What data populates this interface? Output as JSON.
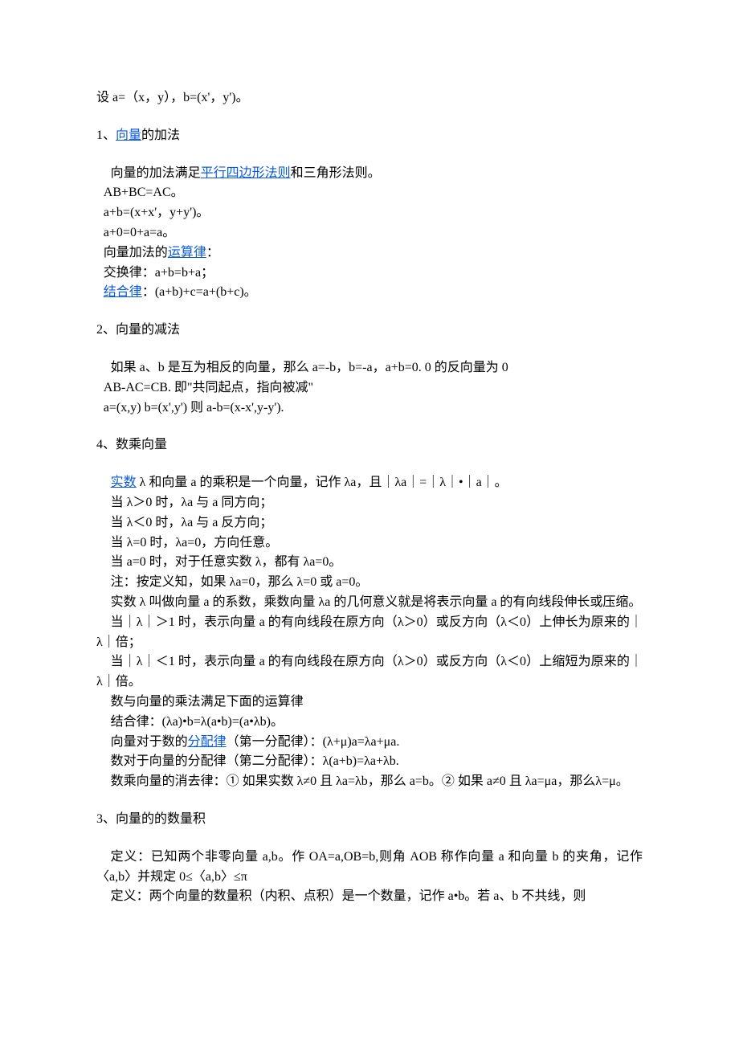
{
  "intro": "设 a=（x，y），b=(x'，y')。",
  "sec1": {
    "title": "1、",
    "link": "向量",
    "title_after": "的加法",
    "l1_pre": "向量的加法满足",
    "l1_link": "平行四边形法则",
    "l1_post": "和三角形法则。",
    "l2": "AB+BC=AC。",
    "l3": "a+b=(x+x'，y+y')。",
    "l4": "a+0=0+a=a。",
    "l5_pre": "向量加法的",
    "l5_link": "运算律",
    "l5_post": "：",
    "l6": "交换律：a+b=b+a；",
    "l7_link": "结合律",
    "l7_post": "：(a+b)+c=a+(b+c)。"
  },
  "sec2": {
    "title": "2、向量的减法",
    "l1": "如果 a、b 是互为相反的向量，那么 a=-b，b=-a，a+b=0. 0 的反向量为 0",
    "l2": "AB-AC=CB.  即\"共同起点，指向被减\"",
    "l3": "a=(x,y) b=(x',y')  则  a-b=(x-x',y-y')."
  },
  "sec4": {
    "title": "4、数乘向量",
    "l1_link": "实数",
    "l1_post": " λ 和向量 a 的乘积是一个向量，记作 λa，且｜λa｜=｜λ｜•｜a｜。",
    "l2": "当 λ＞0 时，λa 与 a 同方向；",
    "l3": "当 λ＜0 时，λa 与 a 反方向；",
    "l4": "当 λ=0 时，λa=0，方向任意。",
    "l5": "当 a=0 时，对于任意实数 λ，都有 λa=0。",
    "l6": "注：按定义知，如果 λa=0，那么 λ=0 或 a=0。",
    "l7": "实数 λ 叫做向量 a 的系数，乘数向量 λa 的几何意义就是将表示向量 a 的有向线段伸长或压缩。",
    "l8": "当｜λ｜＞1 时，表示向量 a 的有向线段在原方向（λ＞0）或反方向（λ＜0）上伸长为原来的｜λ｜倍；",
    "l9": "当｜λ｜＜1 时，表示向量 a 的有向线段在原方向（λ＞0）或反方向（λ＜0）上缩短为原来的｜λ｜倍。",
    "l10": "数与向量的乘法满足下面的运算律",
    "l11": "结合律：(λa)•b=λ(a•b)=(a•λb)。",
    "l12_pre": "向量对于数的",
    "l12_link": "分配律",
    "l12_post": "（第一分配律）：(λ+μ)a=λa+μa.",
    "l13": "数对于向量的分配律（第二分配律）：λ(a+b)=λa+λb.",
    "l14": "数乘向量的消去律：① 如果实数 λ≠0 且 λa=λb，那么 a=b。② 如果 a≠0 且 λa=μa，那么λ=μ。"
  },
  "sec3": {
    "title": "3、向量的的数量积",
    "l1": "定义：已知两个非零向量 a,b。作 OA=a,OB=b,则角 AOB 称作向量 a 和向量 b 的夹角，记作〈a,b〉并规定 0≤〈a,b〉≤π",
    "l2": "定义：两个向量的数量积（内积、点积）是一个数量，记作 a•b。若 a、b 不共线，则"
  }
}
